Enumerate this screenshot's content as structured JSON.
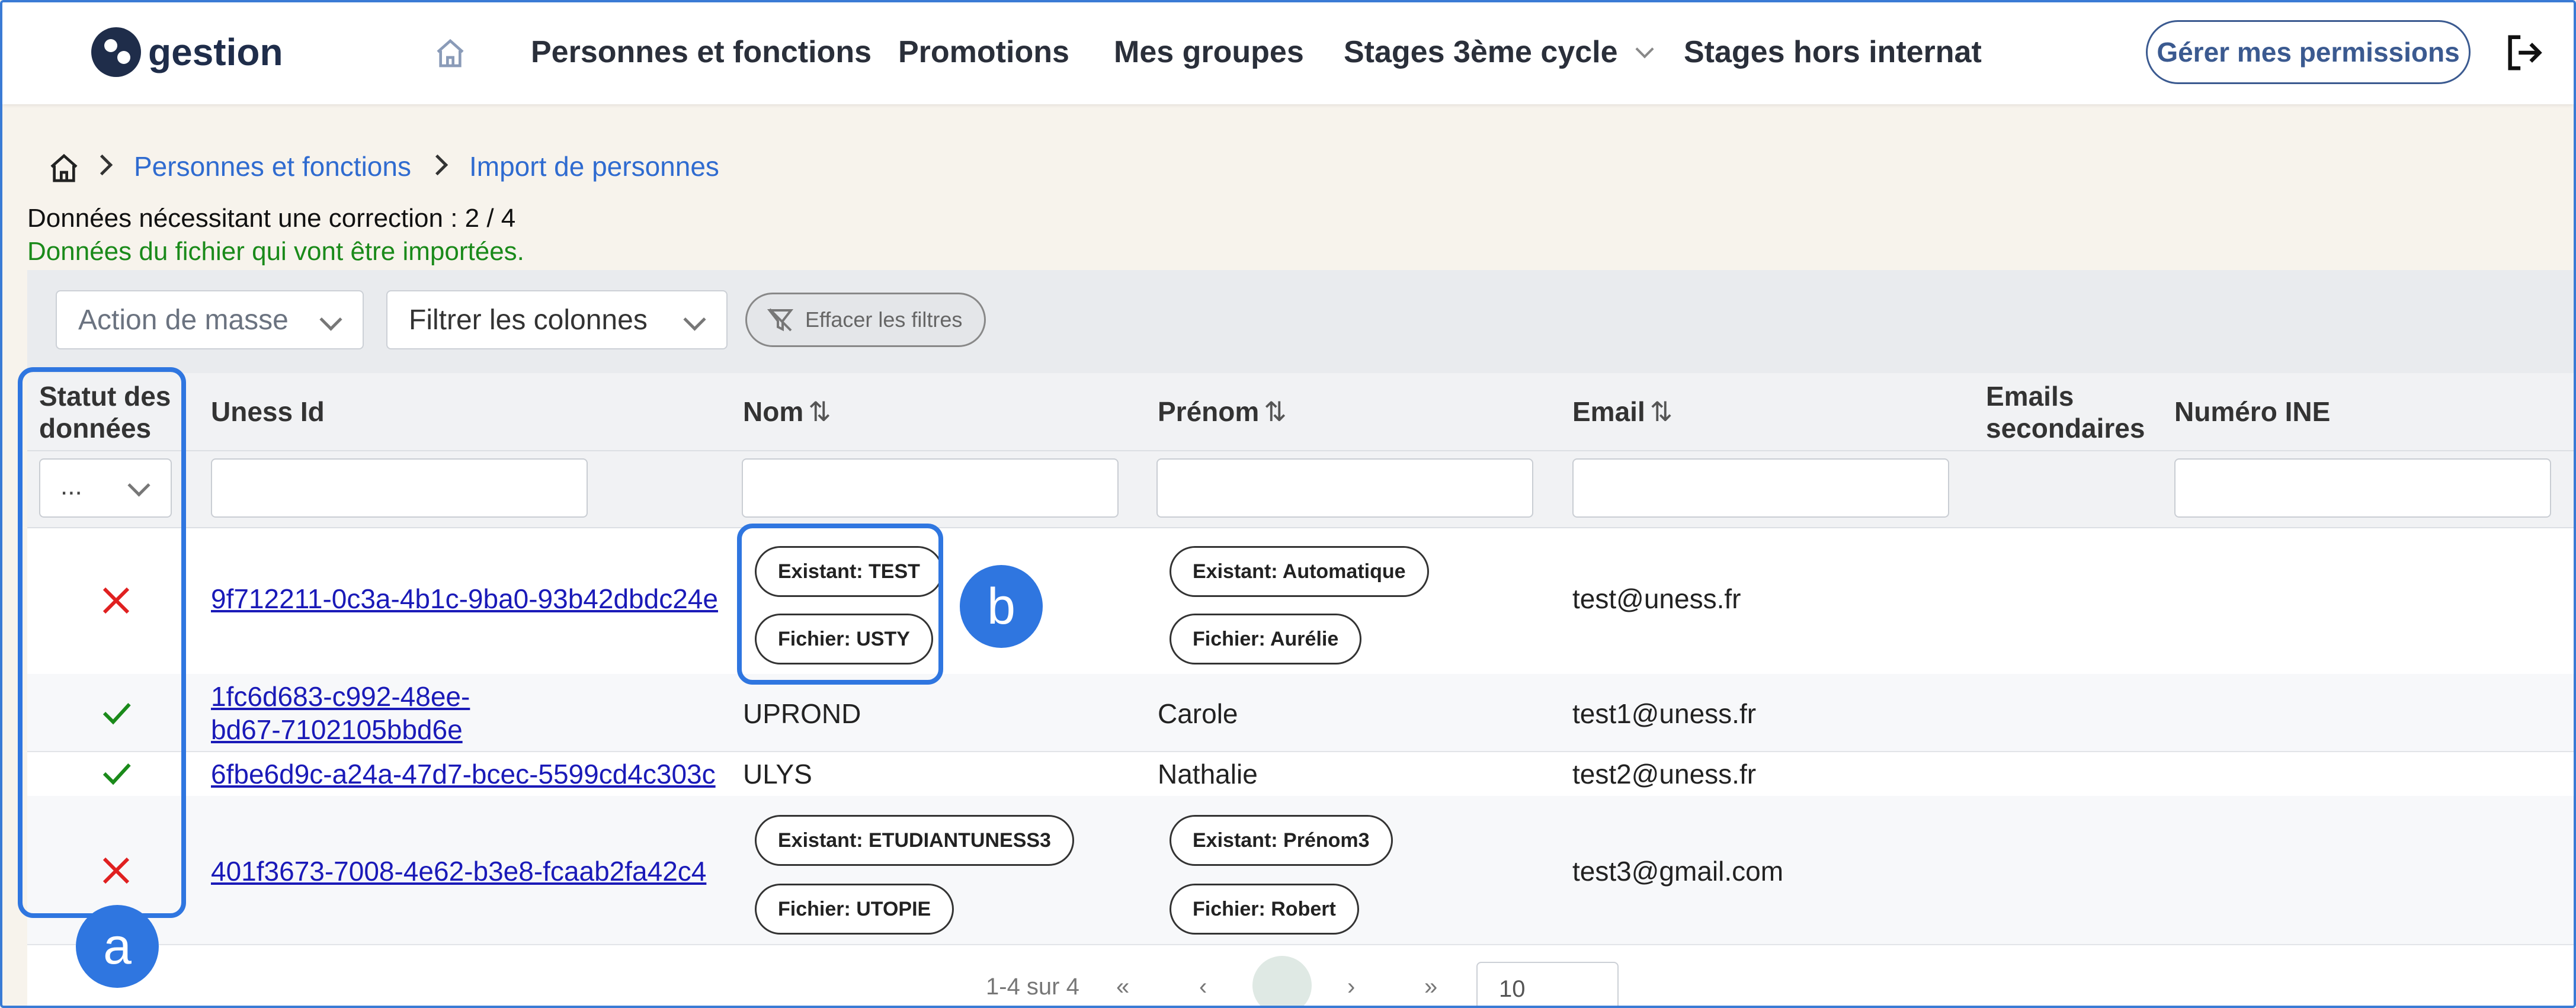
{
  "app": {
    "name": "gestion"
  },
  "nav": {
    "items": [
      "Personnes et fonctions",
      "Promotions",
      "Mes groupes",
      "Stages 3ème cycle",
      "Stages hors internat"
    ],
    "permissions_button": "Gérer mes permissions"
  },
  "breadcrumb": [
    "Personnes et fonctions",
    "Import de personnes"
  ],
  "info": {
    "corrections": "Données nécessitant une correction : 2 / 4",
    "imported": "Données du fichier qui vont être importées."
  },
  "toolbar": {
    "mass_action": "Action de masse",
    "filter_columns": "Filtrer les colonnes",
    "clear_filters": "Effacer les filtres"
  },
  "table": {
    "headers": {
      "status_l1": "Statut des",
      "status_l2": "données",
      "uness_id": "Uness Id",
      "nom": "Nom",
      "prenom": "Prénom",
      "email": "Email",
      "emails_sec_l1": "Emails",
      "emails_sec_l2": "secondaires",
      "ine": "Numéro INE"
    },
    "status_filter": "...",
    "rows": [
      {
        "status": "error",
        "id": "9f712211-0c3a-4b1c-9ba0-93b42dbdc24e",
        "nom_existant": "Existant: TEST",
        "nom_fichier": "Fichier: USTY",
        "prenom_existant": "Existant: Automatique",
        "prenom_fichier": "Fichier: Aurélie",
        "email": "test@uness.fr"
      },
      {
        "status": "ok",
        "id_l1": "1fc6d683-c992-48ee-",
        "id_l2": "bd67-7102105bbd6e",
        "nom": "UPROND",
        "prenom": "Carole",
        "email": "test1@uness.fr"
      },
      {
        "status": "ok",
        "id": "6fbe6d9c-a24a-47d7-bcec-5599cd4c303c",
        "nom": "ULYS",
        "prenom": "Nathalie",
        "email": "test2@uness.fr"
      },
      {
        "status": "error",
        "id": "401f3673-7008-4e62-b3e8-fcaab2fa42c4",
        "nom_existant": "Existant: ETUDIANTUNESS3",
        "nom_fichier": "Fichier: UTOPIE",
        "prenom_existant": "Existant: Prénom3",
        "prenom_fichier": "Fichier: Robert",
        "email": "test3@gmail.com"
      }
    ]
  },
  "pagination": {
    "summary": "1-4 sur 4",
    "page_size": "10"
  },
  "annotations": {
    "a": "a",
    "b": "b"
  },
  "colors": {
    "accent": "#2f76e0",
    "link": "#1a1ab8",
    "success": "#1a8a1a",
    "error": "#e02020"
  }
}
